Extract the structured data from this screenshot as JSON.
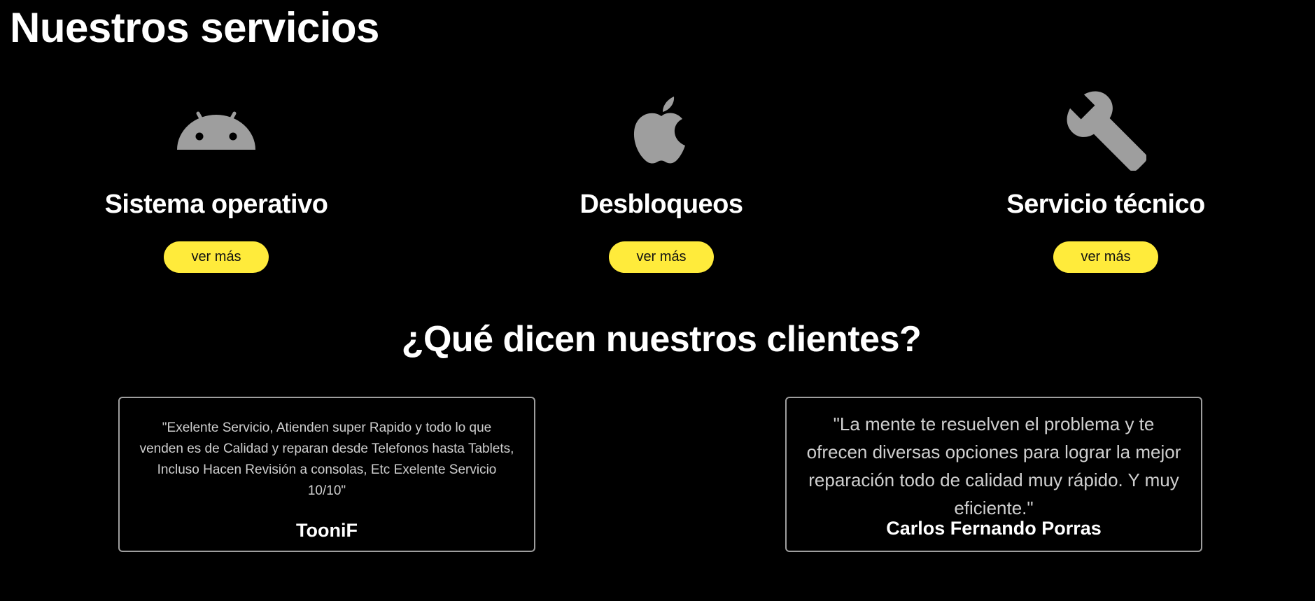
{
  "page": {
    "title": "Nuestros servicios",
    "background": "#000000",
    "accent": "#ffeb3b"
  },
  "services": [
    {
      "icon": "android-icon",
      "name": "Sistema operativo",
      "button": "ver más"
    },
    {
      "icon": "apple-icon",
      "name": "Desbloqueos",
      "button": "ver más"
    },
    {
      "icon": "wrench-icon",
      "name": "Servicio técnico",
      "button": "ver más"
    }
  ],
  "testimonials": {
    "title": "¿Qué dicen nuestros clientes?",
    "items": [
      {
        "quote": "\"Exelente Servicio, Atienden super Rapido y todo lo que venden es de Calidad y reparan desde Telefonos hasta Tablets, Incluso Hacen Revisión a consolas, Etc Exelente Servicio 10/10\"",
        "author": "TooniF"
      },
      {
        "quote": "\"La mente te resuelven el problema y te ofrecen diversas opciones para lograr la mejor reparación todo de calidad muy rápido. Y muy eficiente.\"",
        "author": "Carlos Fernando Porras"
      }
    ]
  }
}
